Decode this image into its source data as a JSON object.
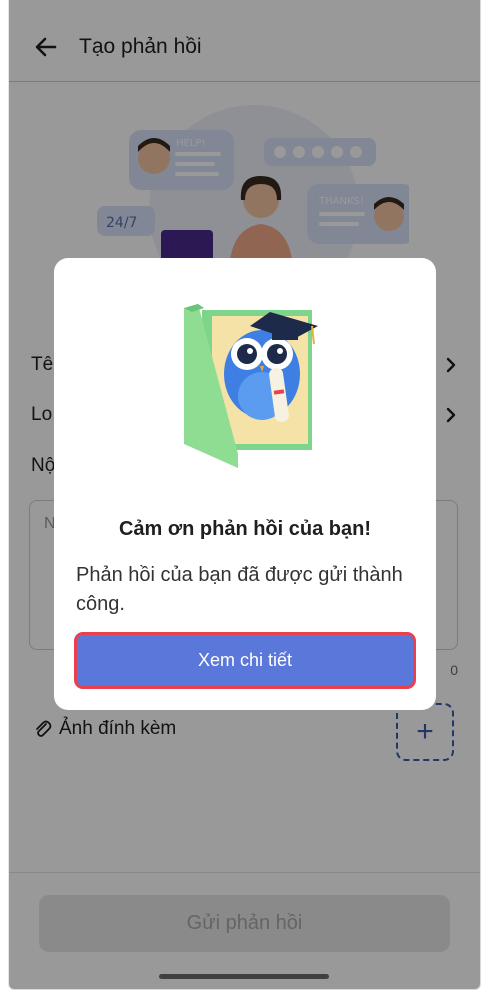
{
  "appbar": {
    "title": "Tạo phản hồi"
  },
  "hero": {
    "help_text": "HELP!",
    "thanks_text": "THANKS!",
    "hours_text": "24/7"
  },
  "form": {
    "name_label": "Tên",
    "type_label": "Lo",
    "content_label": "Nộ",
    "content_placeholder": "N",
    "char_counter": "0",
    "attach_label": "Ảnh đính kèm",
    "add_attach_symbol": "+",
    "submit_label": "Gửi phản hồi"
  },
  "modal": {
    "title": "Cảm ơn phản hồi của bạn!",
    "message": "Phản hồi của bạn đã được gửi thành công.",
    "button_label": "Xem chi tiết"
  },
  "colors": {
    "primary": "#5a78d9",
    "highlight_border": "#e8404e",
    "attach_accent": "#3b5ba9",
    "disabled_button": "#e6e6e6"
  },
  "icons": [
    "back-arrow-icon",
    "chevron-right-icon",
    "paperclip-icon",
    "plus-icon"
  ]
}
